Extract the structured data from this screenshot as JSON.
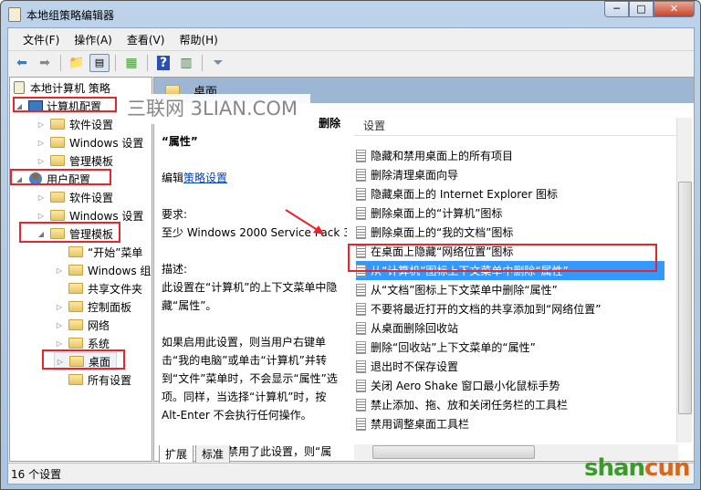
{
  "window": {
    "title": "本地组策略编辑器",
    "minimize": "─",
    "maximize": "□",
    "close": "✕"
  },
  "menu": [
    "文件(F)",
    "操作(A)",
    "查看(V)",
    "帮助(H)"
  ],
  "toolbar": {
    "back": "back-icon",
    "forward": "forward-icon",
    "up": "up-folder-icon",
    "show_tree": "show-hide-tree-icon",
    "export": "export-list-icon",
    "help": "help-icon",
    "show_action": "show-action-pane-icon",
    "filter": "filter-icon"
  },
  "tree": {
    "root": "本地计算机 策略",
    "computer_config": "计算机配置",
    "cc_software": "软件设置",
    "cc_windows": "Windows 设置",
    "cc_admin": "管理模板",
    "user_config": "用户配置",
    "uc_software": "软件设置",
    "uc_windows": "Windows 设置",
    "uc_admin": "管理模板",
    "start_menu": "“开始”菜单",
    "windows_components": "Windows 组件",
    "shared_folders": "共享文件夹",
    "control_panel": "控制面板",
    "network": "网络",
    "system": "系统",
    "desktop": "桌面",
    "all_settings": "所有设置"
  },
  "pane": {
    "header": "桌面",
    "desc_title_tail": "删除",
    "desc_title_2": "“属性”",
    "edit_prefix": "编辑",
    "edit_link": "策略设置",
    "req_label": "要求:",
    "req_value": "至少 Windows 2000 Service Pack 3",
    "desc_label": "描述:",
    "desc_1": "此设置在“计算机”的上下文菜单中隐藏“属性”。",
    "desc_2": "如果启用此设置，则当用户右键单击“我的电脑”或单击“计算机”并转到“文件”菜单时，不会显示“属性”选项。同样，当选择“计算机”时，按 Alt-Enter 不会执行任何操作。",
    "desc_3": "如果未配置或禁用了此设置，则“属性”选项将正常显示。"
  },
  "list": {
    "header": "设置",
    "items": [
      "隐藏和禁用桌面上的所有项目",
      "删除清理桌面向导",
      "隐藏桌面上的 Internet Explorer 图标",
      "删除桌面上的“计算机”图标",
      "删除桌面上的“我的文档”图标",
      "在桌面上隐藏“网络位置”图标",
      "从“计算机”图标上下文菜单中删除“属性”",
      "从“文档”图标上下文菜单中删除“属性”",
      "不要将最近打开的文档的共享添加到“网络位置”",
      "从桌面删除回收站",
      "删除“回收站”上下文菜单的“属性”",
      "退出时不保存设置",
      "关闭 Aero Shake 窗口最小化鼠标手势",
      "禁止添加、拖、放和关闭任务栏的工具栏",
      "禁用调整桌面工具栏"
    ],
    "selected_index": 6
  },
  "tabs": [
    "扩展",
    "标准"
  ],
  "status": "16 个设置",
  "watermark": "三联网 3LIAN.COM",
  "logo": {
    "text_a": "shan",
    "text_b": "cun",
    "sub": "山村网 .net"
  },
  "colors": {
    "highlight": "#3399ff",
    "annotation": "#e8242c",
    "header_band": "#9db6d4"
  }
}
